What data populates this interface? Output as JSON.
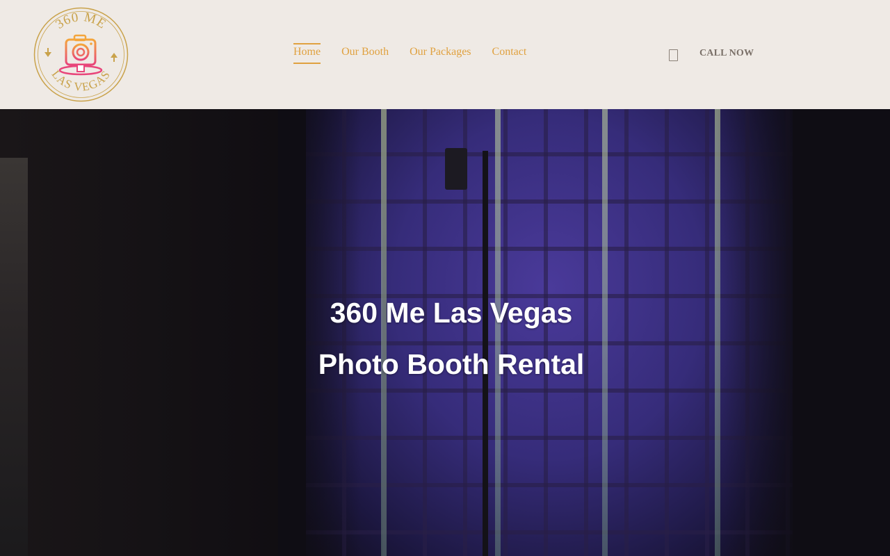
{
  "logo": {
    "top_text": "360 ME",
    "bottom_text": "LAS VEGAS"
  },
  "nav": {
    "items": [
      {
        "label": "Home",
        "active": true
      },
      {
        "label": "Our Booth",
        "active": false
      },
      {
        "label": "Our Packages",
        "active": false
      },
      {
        "label": "Contact",
        "active": false
      }
    ]
  },
  "cta": {
    "icon": "phone-icon",
    "label": "CALL NOW"
  },
  "hero": {
    "title_line1": "360 Me Las Vegas",
    "title_line2": "Photo Booth Rental"
  },
  "colors": {
    "header_bg": "#efeae5",
    "nav_accent": "#e0a13f",
    "cta_text": "#7a7068",
    "logo_gold": "#c9a24a"
  }
}
